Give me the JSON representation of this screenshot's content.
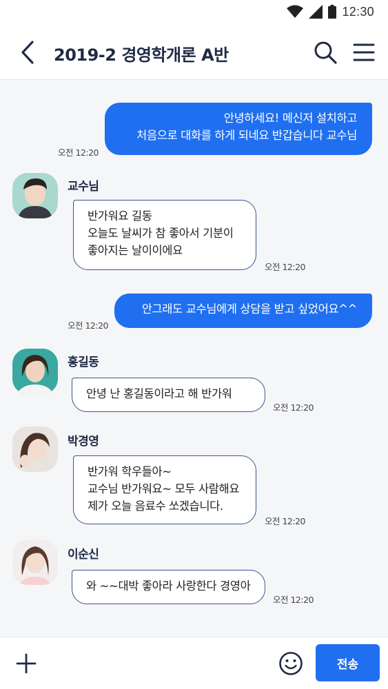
{
  "status_bar": {
    "time": "12:30",
    "icons": [
      "wifi-icon",
      "signal-icon",
      "battery-icon"
    ]
  },
  "header": {
    "title": "2019-2 경영학개론 A반",
    "back_icon": "back-arrow-icon",
    "search_icon": "search-icon",
    "menu_icon": "hamburger-menu-icon"
  },
  "messages": [
    {
      "type": "me",
      "lines": [
        "안녕하세요! 메신저 설치하고",
        "처음으로 대화를 하게 되네요 반갑습니다 교수님"
      ],
      "time": "오전 12:20"
    },
    {
      "type": "them",
      "sender": "교수님",
      "lines": [
        "반가워요 길동",
        "오늘도 날씨가 참 좋아서 기분이",
        "좋아지는 날이이에요"
      ],
      "time": "오전 12:20"
    },
    {
      "type": "me",
      "lines": [
        "안그래도 교수님에게 상담을 받고 싶었어요^^"
      ],
      "time": "오전 12:20"
    },
    {
      "type": "them",
      "sender": "홍길동",
      "lines": [
        "안녕 난 홍길동이라고 해 반가워"
      ],
      "time": "오전 12:20"
    },
    {
      "type": "them",
      "sender": "박경영",
      "lines": [
        "반가워 학우들아~",
        "교수님 반가워요~ 모두 사람해요",
        "제가 오늘 음료수 쏘겠습니다."
      ],
      "time": "오전 12:20"
    },
    {
      "type": "them",
      "sender": "이순신",
      "lines": [
        "와 ~~대박 좋아라 사랑한다 경영아"
      ],
      "time": "오전 12:20"
    }
  ],
  "input_bar": {
    "plus_icon": "plus-icon",
    "emoji_icon": "smiley-icon",
    "send_label": "전송"
  },
  "colors": {
    "accent": "#1f6ff0",
    "bubble_border": "#3d5391",
    "chat_bg": "#f5f6f8",
    "title": "#1f2a44"
  }
}
